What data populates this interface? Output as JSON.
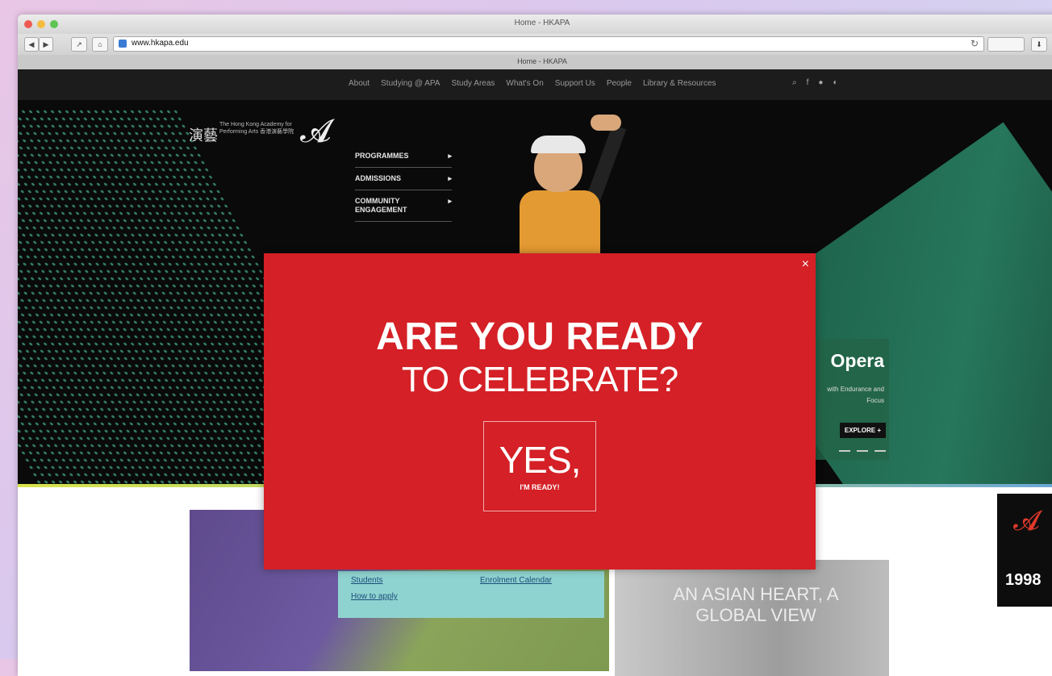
{
  "browser": {
    "window_title": "Home - HKAPA",
    "tab_title": "Home - HKAPA",
    "url": "www.hkapa.edu",
    "back_label": "◀",
    "forward_label": "▶",
    "share_label": "↗",
    "bookmark_label": "⌂"
  },
  "site": {
    "nav": [
      "About",
      "Studying @ APA",
      "Study Areas",
      "What's On",
      "Support Us",
      "People",
      "Library & Resources"
    ],
    "nav_icons": [
      "search-icon",
      "facebook-icon",
      "user-icon",
      "language-icon"
    ],
    "logo_text": "演藝",
    "logo_sub": "The Hong Kong Academy for Performing Arts 香港演藝學院",
    "hero_menu": [
      "PROGRAMMES",
      "ADMISSIONS",
      "COMMUNITY ENGAGEMENT"
    ],
    "opera_card": {
      "title": "Opera",
      "subtitle": "with Endurance and Focus",
      "button": "EXPLORE +"
    },
    "inset_links": [
      "Students",
      "Enrolment Calendar",
      "How to apply"
    ],
    "banner_text": "AN ASIAN HEART, A GLOBAL VIEW",
    "anniversary_year": "1998"
  },
  "modal": {
    "close": "×",
    "headline": "ARE YOU READY",
    "subheadline": "TO CELEBRATE?",
    "cta_big": "YES,",
    "cta_small": "I'M READY!"
  },
  "colors": {
    "modal_red": "#d42026",
    "nav_dark": "#1c1c1c",
    "hero_green": "#2b8a6a"
  }
}
